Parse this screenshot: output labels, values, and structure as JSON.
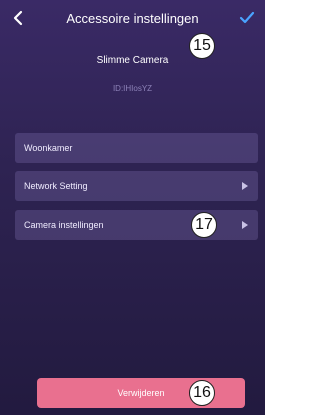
{
  "header": {
    "title": "Accessoire instellingen",
    "back_icon": "chevron-left-icon",
    "confirm_icon": "check-icon"
  },
  "device": {
    "name": "Slimme Camera",
    "id": "ID:IHIosYZ"
  },
  "settings": {
    "items": [
      {
        "label": "Woonkamer",
        "has_arrow": false
      },
      {
        "label": "Network Setting",
        "has_arrow": true
      },
      {
        "label": "Camera instellingen",
        "has_arrow": true
      }
    ]
  },
  "actions": {
    "delete_label": "Verwijderen"
  },
  "callouts": {
    "c15": "15",
    "c16": "16",
    "c17": "17"
  },
  "colors": {
    "background": "#2e2352",
    "row": "#4a3d75",
    "delete_button": "#e9708f",
    "check": "#4aa3ff",
    "id_text": "#8d82b8"
  }
}
